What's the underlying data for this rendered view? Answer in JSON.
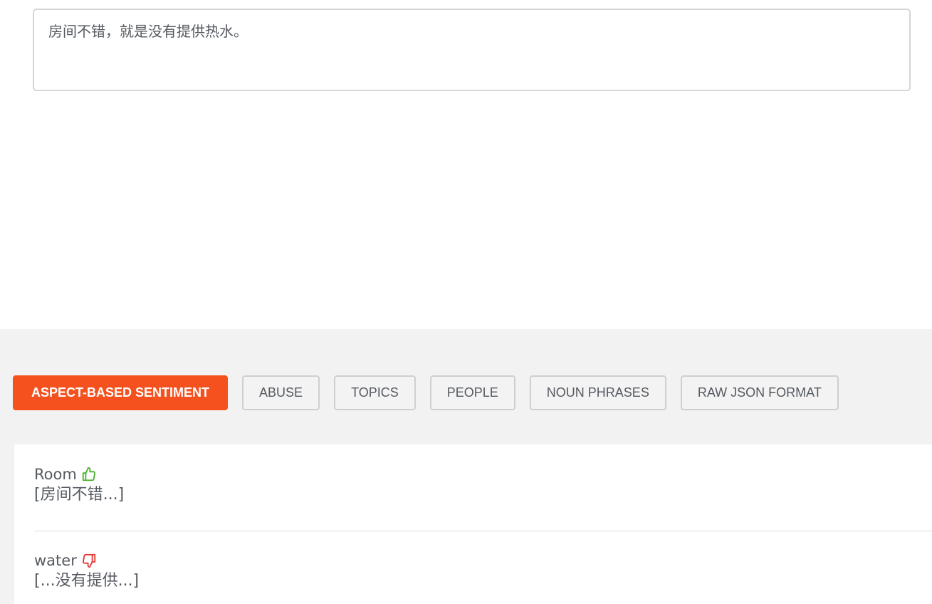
{
  "input": {
    "text": "房间不错，就是没有提供热水。"
  },
  "tabs": [
    {
      "label": "ASPECT-BASED SENTIMENT",
      "active": true
    },
    {
      "label": "ABUSE",
      "active": false
    },
    {
      "label": "TOPICS",
      "active": false
    },
    {
      "label": "PEOPLE",
      "active": false
    },
    {
      "label": "NOUN PHRASES",
      "active": false
    },
    {
      "label": "RAW JSON FORMAT",
      "active": false
    }
  ],
  "aspects": [
    {
      "name": "Room",
      "sentiment_icon": "thumbs-up-icon",
      "snippet": "[房间不错...]"
    },
    {
      "name": "water",
      "sentiment_icon": "thumbs-down-icon",
      "snippet": "[...没有提供...]"
    }
  ],
  "colors": {
    "accent": "#f4511e",
    "positive": "#4caf2a",
    "negative": "#e53935"
  }
}
